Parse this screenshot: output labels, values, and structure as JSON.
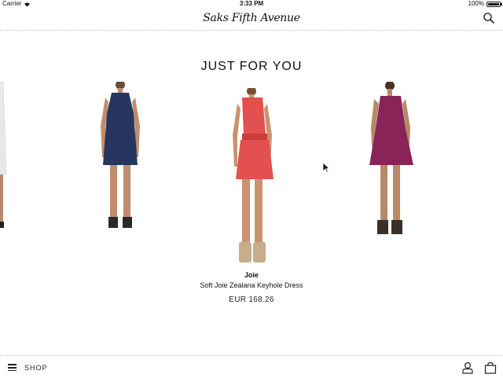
{
  "status_bar": {
    "carrier": "Carrier",
    "time": "3:33 PM",
    "battery": "100%"
  },
  "header": {
    "logo_text": "Saks Fifth Avenue",
    "search_icon": "search-icon"
  },
  "main": {
    "section_title": "JUST FOR YOU",
    "products": [
      {
        "dress_color": "#e8e8e6",
        "partial": true
      },
      {
        "dress_color": "#26365e"
      },
      {
        "dress_color": "#e2504f",
        "selected": true
      },
      {
        "dress_color": "#8a2458"
      }
    ],
    "selected_product": {
      "brand": "Joie",
      "name": "Soft Joie Zealana Keyhole Dress",
      "price": "EUR 168.26"
    }
  },
  "bottom_bar": {
    "menu_label": "SHOP",
    "menu_icon": "hamburger-icon",
    "account_icon": "account-icon",
    "bag_icon": "shopping-bag-icon"
  },
  "colors": {
    "text": "#111111",
    "divider": "#c9c9c9",
    "background": "#ffffff"
  }
}
